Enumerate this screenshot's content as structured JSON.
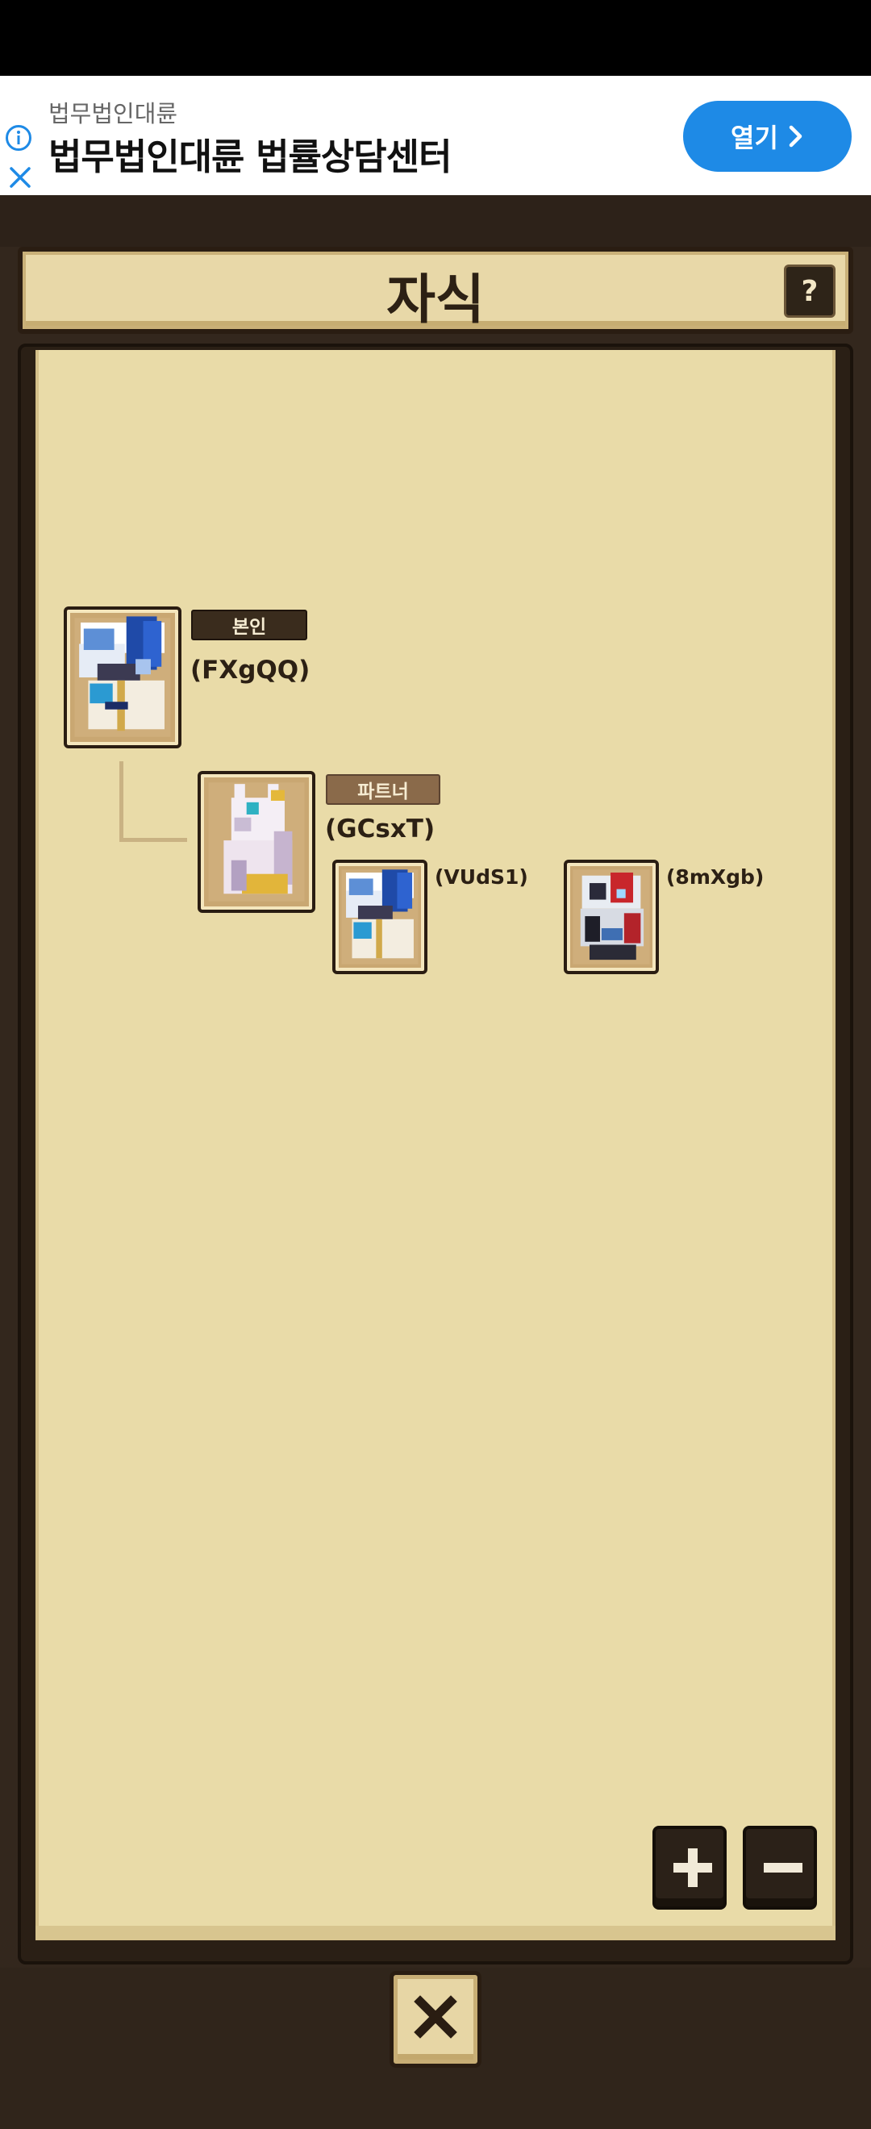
{
  "ad": {
    "sponsor": "법무법인대륜",
    "headline": "법무법인대륜 법률상담센터",
    "open_label": "열기",
    "info_icon": "info-icon",
    "close_icon": "close-icon",
    "accent_color": "#1e8ae6"
  },
  "screen": {
    "title": "자식",
    "help_label": "?"
  },
  "tree": {
    "self": {
      "badge": "본인",
      "name": "(FXgQQ)"
    },
    "partner": {
      "badge": "파트너",
      "name": "(GCsxT)"
    },
    "children": [
      {
        "name": "(VUdS1)"
      },
      {
        "name": "(8mXgb)"
      }
    ]
  },
  "controls": {
    "zoom_in_icon": "plus-icon",
    "zoom_out_icon": "minus-icon",
    "close_icon": "x-icon"
  },
  "colors": {
    "paper": "#e9dba8",
    "frame": "#2a1f15",
    "self_badge": "#3a2c1d",
    "partner_badge": "#8a6a4a"
  }
}
